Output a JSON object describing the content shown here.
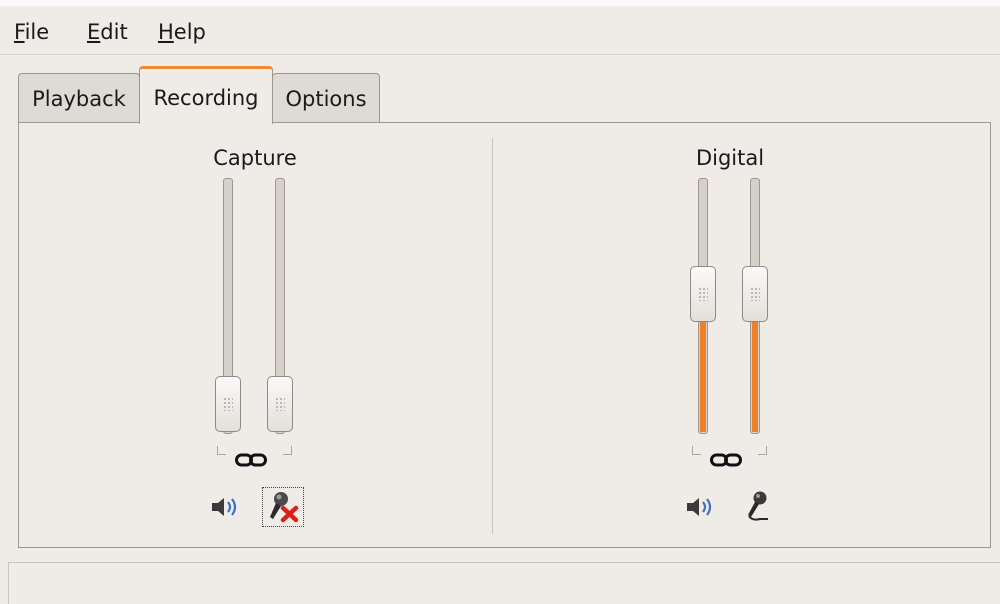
{
  "menubar": {
    "items": [
      {
        "label": "File",
        "mnemonic": "F",
        "rest": "ile"
      },
      {
        "label": "Edit",
        "mnemonic": "E",
        "rest": "dit"
      },
      {
        "label": "Help",
        "mnemonic": "H",
        "rest": "elp"
      }
    ]
  },
  "tabs": [
    {
      "label": "Playback",
      "active": false
    },
    {
      "label": "Recording",
      "active": true
    },
    {
      "label": "Options",
      "active": false
    }
  ],
  "sections": [
    {
      "label": "Capture",
      "channels": [
        {
          "name": "left",
          "level": 0.0
        },
        {
          "name": "right",
          "level": 0.0
        }
      ],
      "channels_locked": true,
      "icons": [
        "speaker-icon",
        "microphone-muted-icon"
      ],
      "record_muted": true
    },
    {
      "label": "Digital",
      "channels": [
        {
          "name": "left",
          "level": 0.57
        },
        {
          "name": "right",
          "level": 0.57
        }
      ],
      "channels_locked": true,
      "icons": [
        "speaker-icon",
        "microphone-icon"
      ],
      "record_muted": false
    }
  ],
  "colors": {
    "accent": "#f08025",
    "window_bg": "#efebe7",
    "mute_cross": "#d9201a"
  }
}
